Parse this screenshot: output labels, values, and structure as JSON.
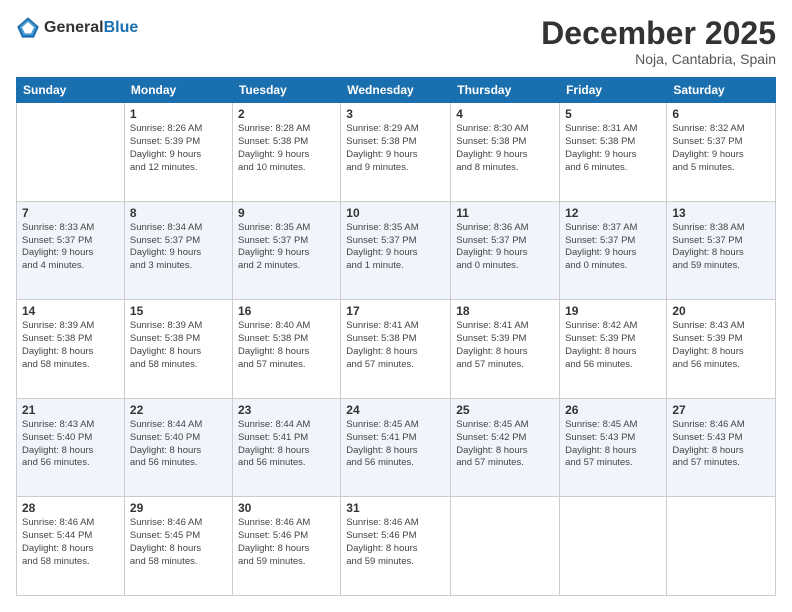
{
  "header": {
    "logo_line1": "General",
    "logo_line2": "Blue",
    "month": "December 2025",
    "location": "Noja, Cantabria, Spain"
  },
  "weekdays": [
    "Sunday",
    "Monday",
    "Tuesday",
    "Wednesday",
    "Thursday",
    "Friday",
    "Saturday"
  ],
  "weeks": [
    [
      {
        "day": "",
        "info": ""
      },
      {
        "day": "1",
        "info": "Sunrise: 8:26 AM\nSunset: 5:39 PM\nDaylight: 9 hours\nand 12 minutes."
      },
      {
        "day": "2",
        "info": "Sunrise: 8:28 AM\nSunset: 5:38 PM\nDaylight: 9 hours\nand 10 minutes."
      },
      {
        "day": "3",
        "info": "Sunrise: 8:29 AM\nSunset: 5:38 PM\nDaylight: 9 hours\nand 9 minutes."
      },
      {
        "day": "4",
        "info": "Sunrise: 8:30 AM\nSunset: 5:38 PM\nDaylight: 9 hours\nand 8 minutes."
      },
      {
        "day": "5",
        "info": "Sunrise: 8:31 AM\nSunset: 5:38 PM\nDaylight: 9 hours\nand 6 minutes."
      },
      {
        "day": "6",
        "info": "Sunrise: 8:32 AM\nSunset: 5:37 PM\nDaylight: 9 hours\nand 5 minutes."
      }
    ],
    [
      {
        "day": "7",
        "info": "Sunrise: 8:33 AM\nSunset: 5:37 PM\nDaylight: 9 hours\nand 4 minutes."
      },
      {
        "day": "8",
        "info": "Sunrise: 8:34 AM\nSunset: 5:37 PM\nDaylight: 9 hours\nand 3 minutes."
      },
      {
        "day": "9",
        "info": "Sunrise: 8:35 AM\nSunset: 5:37 PM\nDaylight: 9 hours\nand 2 minutes."
      },
      {
        "day": "10",
        "info": "Sunrise: 8:35 AM\nSunset: 5:37 PM\nDaylight: 9 hours\nand 1 minute."
      },
      {
        "day": "11",
        "info": "Sunrise: 8:36 AM\nSunset: 5:37 PM\nDaylight: 9 hours\nand 0 minutes."
      },
      {
        "day": "12",
        "info": "Sunrise: 8:37 AM\nSunset: 5:37 PM\nDaylight: 9 hours\nand 0 minutes."
      },
      {
        "day": "13",
        "info": "Sunrise: 8:38 AM\nSunset: 5:37 PM\nDaylight: 8 hours\nand 59 minutes."
      }
    ],
    [
      {
        "day": "14",
        "info": "Sunrise: 8:39 AM\nSunset: 5:38 PM\nDaylight: 8 hours\nand 58 minutes."
      },
      {
        "day": "15",
        "info": "Sunrise: 8:39 AM\nSunset: 5:38 PM\nDaylight: 8 hours\nand 58 minutes."
      },
      {
        "day": "16",
        "info": "Sunrise: 8:40 AM\nSunset: 5:38 PM\nDaylight: 8 hours\nand 57 minutes."
      },
      {
        "day": "17",
        "info": "Sunrise: 8:41 AM\nSunset: 5:38 PM\nDaylight: 8 hours\nand 57 minutes."
      },
      {
        "day": "18",
        "info": "Sunrise: 8:41 AM\nSunset: 5:39 PM\nDaylight: 8 hours\nand 57 minutes."
      },
      {
        "day": "19",
        "info": "Sunrise: 8:42 AM\nSunset: 5:39 PM\nDaylight: 8 hours\nand 56 minutes."
      },
      {
        "day": "20",
        "info": "Sunrise: 8:43 AM\nSunset: 5:39 PM\nDaylight: 8 hours\nand 56 minutes."
      }
    ],
    [
      {
        "day": "21",
        "info": "Sunrise: 8:43 AM\nSunset: 5:40 PM\nDaylight: 8 hours\nand 56 minutes."
      },
      {
        "day": "22",
        "info": "Sunrise: 8:44 AM\nSunset: 5:40 PM\nDaylight: 8 hours\nand 56 minutes."
      },
      {
        "day": "23",
        "info": "Sunrise: 8:44 AM\nSunset: 5:41 PM\nDaylight: 8 hours\nand 56 minutes."
      },
      {
        "day": "24",
        "info": "Sunrise: 8:45 AM\nSunset: 5:41 PM\nDaylight: 8 hours\nand 56 minutes."
      },
      {
        "day": "25",
        "info": "Sunrise: 8:45 AM\nSunset: 5:42 PM\nDaylight: 8 hours\nand 57 minutes."
      },
      {
        "day": "26",
        "info": "Sunrise: 8:45 AM\nSunset: 5:43 PM\nDaylight: 8 hours\nand 57 minutes."
      },
      {
        "day": "27",
        "info": "Sunrise: 8:46 AM\nSunset: 5:43 PM\nDaylight: 8 hours\nand 57 minutes."
      }
    ],
    [
      {
        "day": "28",
        "info": "Sunrise: 8:46 AM\nSunset: 5:44 PM\nDaylight: 8 hours\nand 58 minutes."
      },
      {
        "day": "29",
        "info": "Sunrise: 8:46 AM\nSunset: 5:45 PM\nDaylight: 8 hours\nand 58 minutes."
      },
      {
        "day": "30",
        "info": "Sunrise: 8:46 AM\nSunset: 5:46 PM\nDaylight: 8 hours\nand 59 minutes."
      },
      {
        "day": "31",
        "info": "Sunrise: 8:46 AM\nSunset: 5:46 PM\nDaylight: 8 hours\nand 59 minutes."
      },
      {
        "day": "",
        "info": ""
      },
      {
        "day": "",
        "info": ""
      },
      {
        "day": "",
        "info": ""
      }
    ]
  ]
}
